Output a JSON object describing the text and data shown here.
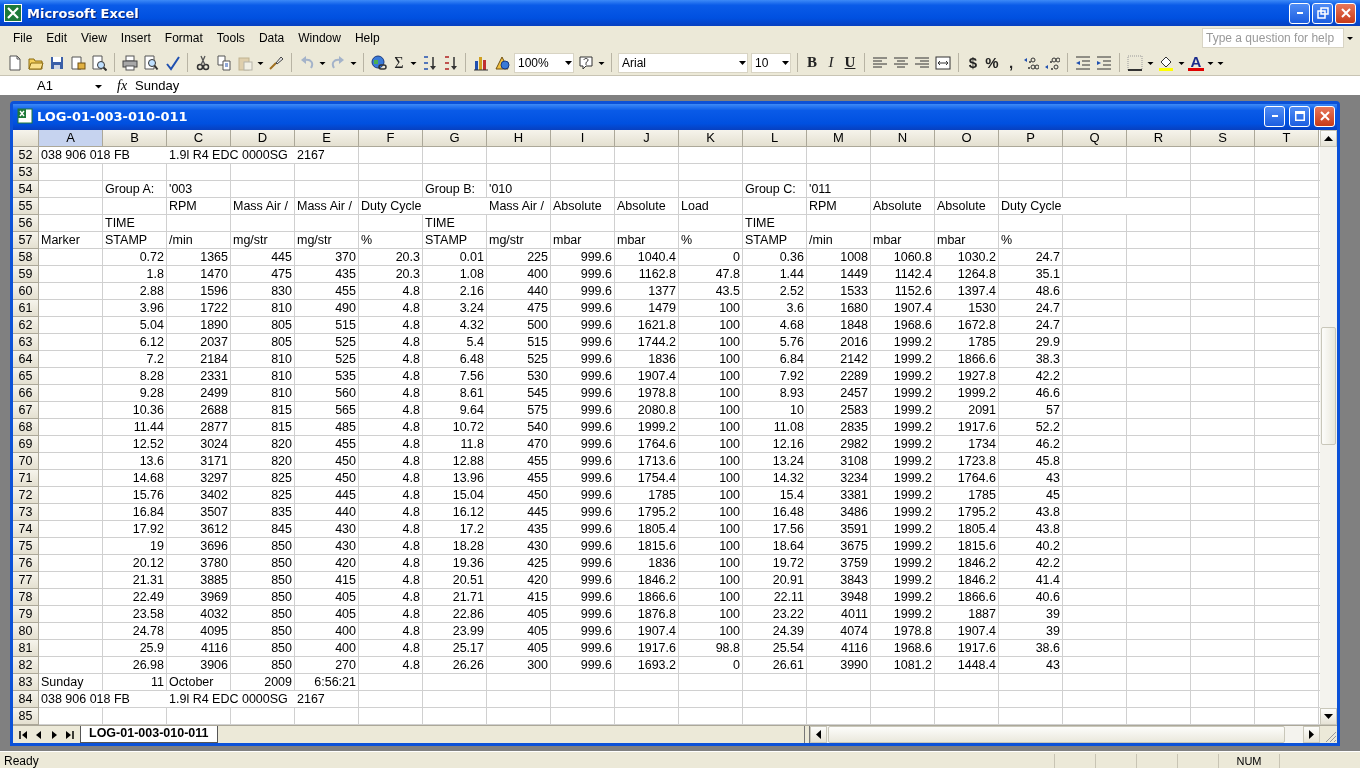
{
  "window": {
    "title": "Microsoft Excel"
  },
  "menu": [
    {
      "label": "File"
    },
    {
      "label": "Edit"
    },
    {
      "label": "View"
    },
    {
      "label": "Insert"
    },
    {
      "label": "Format"
    },
    {
      "label": "Tools"
    },
    {
      "label": "Data"
    },
    {
      "label": "Window"
    },
    {
      "label": "Help"
    }
  ],
  "help_search": {
    "placeholder": "Type a question for help"
  },
  "toolbar": {
    "undo": {
      "disabled": true
    },
    "redo": {
      "disabled": true
    },
    "paste": {
      "disabled": true
    },
    "sum": "Σ",
    "zoom": "100%",
    "font": "Arial",
    "font_size": "10",
    "bold": "B",
    "italic": "I",
    "underline": "U",
    "currency": "$",
    "percent": "%",
    "comma": ",",
    "font_color": "A"
  },
  "formula_bar": {
    "name_box": "A1",
    "fx": "fx",
    "value": "Sunday"
  },
  "workbook": {
    "title": "LOG-01-003-010-011",
    "columns": [
      {
        "label": "A",
        "selected": true
      },
      {
        "label": "B",
        "selected": false
      },
      {
        "label": "C",
        "selected": false
      },
      {
        "label": "D",
        "selected": false
      },
      {
        "label": "E",
        "selected": false
      },
      {
        "label": "F",
        "selected": false
      },
      {
        "label": "G",
        "selected": false
      },
      {
        "label": "H",
        "selected": false
      },
      {
        "label": "I",
        "selected": false
      },
      {
        "label": "J",
        "selected": false
      },
      {
        "label": "K",
        "selected": false
      },
      {
        "label": "L",
        "selected": false
      },
      {
        "label": "M",
        "selected": false
      },
      {
        "label": "N",
        "selected": false
      },
      {
        "label": "O",
        "selected": false
      },
      {
        "label": "P",
        "selected": false
      },
      {
        "label": "Q",
        "selected": false
      },
      {
        "label": "R",
        "selected": false
      },
      {
        "label": "S",
        "selected": false
      },
      {
        "label": "T",
        "selected": false
      }
    ],
    "rows": [
      {
        "header": "52",
        "kind": "text",
        "cells": [
          {
            "kind": "text",
            "text": "038 906 018 FB"
          },
          null,
          {
            "kind": "text",
            "text": "1.9l R4 EDC 0000SG"
          },
          null,
          {
            "kind": "text",
            "text": "2167"
          }
        ]
      },
      {
        "header": "53",
        "kind": "empty"
      },
      {
        "header": "54",
        "kind": "text",
        "cells": [
          null,
          {
            "kind": "text",
            "text": "Group A:"
          },
          {
            "kind": "text",
            "text": "'003"
          },
          null,
          null,
          null,
          {
            "kind": "text",
            "text": "Group B:"
          },
          {
            "kind": "text",
            "text": "'010"
          },
          null,
          null,
          null,
          {
            "kind": "text",
            "text": "Group C:"
          },
          {
            "kind": "text",
            "text": "'011"
          }
        ]
      },
      {
        "header": "55",
        "kind": "text",
        "cells": [
          null,
          null,
          {
            "kind": "text",
            "text": "RPM"
          },
          {
            "kind": "text",
            "text": "Mass Air /"
          },
          {
            "kind": "text",
            "text": "Mass Air /"
          },
          {
            "kind": "text",
            "text": "Duty Cycle"
          },
          null,
          {
            "kind": "text",
            "text": "Mass Air /"
          },
          {
            "kind": "text",
            "text": "Absolute"
          },
          {
            "kind": "text",
            "text": "Absolute"
          },
          {
            "kind": "text",
            "text": "Load"
          },
          null,
          {
            "kind": "text",
            "text": "RPM"
          },
          {
            "kind": "text",
            "text": "Absolute"
          },
          {
            "kind": "text",
            "text": "Absolute"
          },
          {
            "kind": "text",
            "text": "Duty Cycle"
          }
        ]
      },
      {
        "header": "56",
        "kind": "text",
        "cells": [
          null,
          {
            "kind": "text",
            "text": "TIME"
          },
          null,
          null,
          null,
          null,
          {
            "kind": "text",
            "text": "TIME"
          },
          null,
          null,
          null,
          null,
          {
            "kind": "text",
            "text": "TIME"
          }
        ]
      },
      {
        "header": "57",
        "kind": "text",
        "cells": [
          {
            "kind": "text",
            "text": "Marker"
          },
          {
            "kind": "text",
            "text": "STAMP"
          },
          {
            "kind": "text",
            "text": "/min"
          },
          {
            "kind": "text",
            "text": "mg/str"
          },
          {
            "kind": "text",
            "text": "mg/str"
          },
          {
            "kind": "text",
            "text": "%"
          },
          {
            "kind": "text",
            "text": "STAMP"
          },
          {
            "kind": "text",
            "text": "mg/str"
          },
          {
            "kind": "text",
            "text": "mbar"
          },
          {
            "kind": "text",
            "text": "mbar"
          },
          {
            "kind": "text",
            "text": "%"
          },
          {
            "kind": "text",
            "text": "STAMP"
          },
          {
            "kind": "text",
            "text": "/min"
          },
          {
            "kind": "text",
            "text": "mbar"
          },
          {
            "kind": "text",
            "text": "mbar"
          },
          {
            "kind": "text",
            "text": "%"
          }
        ]
      },
      {
        "header": "58",
        "kind": "data",
        "values": [
          "0.72",
          "1365",
          "445",
          "370",
          "20.3",
          "0.01",
          "225",
          "999.6",
          "1040.4",
          "0",
          "0.36",
          "1008",
          "1060.8",
          "1030.2",
          "24.7"
        ]
      },
      {
        "header": "59",
        "kind": "data",
        "values": [
          "1.8",
          "1470",
          "475",
          "435",
          "20.3",
          "1.08",
          "400",
          "999.6",
          "1162.8",
          "47.8",
          "1.44",
          "1449",
          "1142.4",
          "1264.8",
          "35.1"
        ]
      },
      {
        "header": "60",
        "kind": "data",
        "values": [
          "2.88",
          "1596",
          "830",
          "455",
          "4.8",
          "2.16",
          "440",
          "999.6",
          "1377",
          "43.5",
          "2.52",
          "1533",
          "1152.6",
          "1397.4",
          "48.6"
        ]
      },
      {
        "header": "61",
        "kind": "data",
        "values": [
          "3.96",
          "1722",
          "810",
          "490",
          "4.8",
          "3.24",
          "475",
          "999.6",
          "1479",
          "100",
          "3.6",
          "1680",
          "1907.4",
          "1530",
          "24.7"
        ]
      },
      {
        "header": "62",
        "kind": "data",
        "values": [
          "5.04",
          "1890",
          "805",
          "515",
          "4.8",
          "4.32",
          "500",
          "999.6",
          "1621.8",
          "100",
          "4.68",
          "1848",
          "1968.6",
          "1672.8",
          "24.7"
        ]
      },
      {
        "header": "63",
        "kind": "data",
        "values": [
          "6.12",
          "2037",
          "805",
          "525",
          "4.8",
          "5.4",
          "515",
          "999.6",
          "1744.2",
          "100",
          "5.76",
          "2016",
          "1999.2",
          "1785",
          "29.9"
        ]
      },
      {
        "header": "64",
        "kind": "data",
        "values": [
          "7.2",
          "2184",
          "810",
          "525",
          "4.8",
          "6.48",
          "525",
          "999.6",
          "1836",
          "100",
          "6.84",
          "2142",
          "1999.2",
          "1866.6",
          "38.3"
        ]
      },
      {
        "header": "65",
        "kind": "data",
        "values": [
          "8.28",
          "2331",
          "810",
          "535",
          "4.8",
          "7.56",
          "530",
          "999.6",
          "1907.4",
          "100",
          "7.92",
          "2289",
          "1999.2",
          "1927.8",
          "42.2"
        ]
      },
      {
        "header": "66",
        "kind": "data",
        "values": [
          "9.28",
          "2499",
          "810",
          "560",
          "4.8",
          "8.61",
          "545",
          "999.6",
          "1978.8",
          "100",
          "8.93",
          "2457",
          "1999.2",
          "1999.2",
          "46.6"
        ]
      },
      {
        "header": "67",
        "kind": "data",
        "values": [
          "10.36",
          "2688",
          "815",
          "565",
          "4.8",
          "9.64",
          "575",
          "999.6",
          "2080.8",
          "100",
          "10",
          "2583",
          "1999.2",
          "2091",
          "57"
        ]
      },
      {
        "header": "68",
        "kind": "data",
        "values": [
          "11.44",
          "2877",
          "815",
          "485",
          "4.8",
          "10.72",
          "540",
          "999.6",
          "1999.2",
          "100",
          "11.08",
          "2835",
          "1999.2",
          "1917.6",
          "52.2"
        ]
      },
      {
        "header": "69",
        "kind": "data",
        "values": [
          "12.52",
          "3024",
          "820",
          "455",
          "4.8",
          "11.8",
          "470",
          "999.6",
          "1764.6",
          "100",
          "12.16",
          "2982",
          "1999.2",
          "1734",
          "46.2"
        ]
      },
      {
        "header": "70",
        "kind": "data",
        "values": [
          "13.6",
          "3171",
          "820",
          "450",
          "4.8",
          "12.88",
          "455",
          "999.6",
          "1713.6",
          "100",
          "13.24",
          "3108",
          "1999.2",
          "1723.8",
          "45.8"
        ]
      },
      {
        "header": "71",
        "kind": "data",
        "values": [
          "14.68",
          "3297",
          "825",
          "450",
          "4.8",
          "13.96",
          "455",
          "999.6",
          "1754.4",
          "100",
          "14.32",
          "3234",
          "1999.2",
          "1764.6",
          "43"
        ]
      },
      {
        "header": "72",
        "kind": "data",
        "values": [
          "15.76",
          "3402",
          "825",
          "445",
          "4.8",
          "15.04",
          "450",
          "999.6",
          "1785",
          "100",
          "15.4",
          "3381",
          "1999.2",
          "1785",
          "45"
        ]
      },
      {
        "header": "73",
        "kind": "data",
        "values": [
          "16.84",
          "3507",
          "835",
          "440",
          "4.8",
          "16.12",
          "445",
          "999.6",
          "1795.2",
          "100",
          "16.48",
          "3486",
          "1999.2",
          "1795.2",
          "43.8"
        ]
      },
      {
        "header": "74",
        "kind": "data",
        "values": [
          "17.92",
          "3612",
          "845",
          "430",
          "4.8",
          "17.2",
          "435",
          "999.6",
          "1805.4",
          "100",
          "17.56",
          "3591",
          "1999.2",
          "1805.4",
          "43.8"
        ]
      },
      {
        "header": "75",
        "kind": "data",
        "values": [
          "19",
          "3696",
          "850",
          "430",
          "4.8",
          "18.28",
          "430",
          "999.6",
          "1815.6",
          "100",
          "18.64",
          "3675",
          "1999.2",
          "1815.6",
          "40.2"
        ]
      },
      {
        "header": "76",
        "kind": "data",
        "values": [
          "20.12",
          "3780",
          "850",
          "420",
          "4.8",
          "19.36",
          "425",
          "999.6",
          "1836",
          "100",
          "19.72",
          "3759",
          "1999.2",
          "1846.2",
          "42.2"
        ]
      },
      {
        "header": "77",
        "kind": "data",
        "values": [
          "21.31",
          "3885",
          "850",
          "415",
          "4.8",
          "20.51",
          "420",
          "999.6",
          "1846.2",
          "100",
          "20.91",
          "3843",
          "1999.2",
          "1846.2",
          "41.4"
        ]
      },
      {
        "header": "78",
        "kind": "data",
        "values": [
          "22.49",
          "3969",
          "850",
          "405",
          "4.8",
          "21.71",
          "415",
          "999.6",
          "1866.6",
          "100",
          "22.11",
          "3948",
          "1999.2",
          "1866.6",
          "40.6"
        ]
      },
      {
        "header": "79",
        "kind": "data",
        "values": [
          "23.58",
          "4032",
          "850",
          "405",
          "4.8",
          "22.86",
          "405",
          "999.6",
          "1876.8",
          "100",
          "23.22",
          "4011",
          "1999.2",
          "1887",
          "39"
        ]
      },
      {
        "header": "80",
        "kind": "data",
        "values": [
          "24.78",
          "4095",
          "850",
          "400",
          "4.8",
          "23.99",
          "405",
          "999.6",
          "1907.4",
          "100",
          "24.39",
          "4074",
          "1978.8",
          "1907.4",
          "39"
        ]
      },
      {
        "header": "81",
        "kind": "data",
        "values": [
          "25.9",
          "4116",
          "850",
          "400",
          "4.8",
          "25.17",
          "405",
          "999.6",
          "1917.6",
          "98.8",
          "25.54",
          "4116",
          "1968.6",
          "1917.6",
          "38.6"
        ]
      },
      {
        "header": "82",
        "kind": "data",
        "values": [
          "26.98",
          "3906",
          "850",
          "270",
          "4.8",
          "26.26",
          "300",
          "999.6",
          "1693.2",
          "0",
          "26.61",
          "3990",
          "1081.2",
          "1448.4",
          "43"
        ]
      },
      {
        "header": "83",
        "kind": "text",
        "cells": [
          {
            "kind": "text",
            "text": "Sunday"
          },
          {
            "kind": "number",
            "text": "11"
          },
          {
            "kind": "text",
            "text": "October"
          },
          {
            "kind": "number",
            "text": "2009"
          },
          {
            "kind": "number",
            "text": "6:56:21"
          }
        ]
      },
      {
        "header": "84",
        "kind": "text",
        "cells": [
          {
            "kind": "text",
            "text": "038 906 018 FB"
          },
          null,
          {
            "kind": "text",
            "text": "1.9l R4 EDC 0000SG"
          },
          null,
          {
            "kind": "text",
            "text": "2167"
          }
        ]
      },
      {
        "header": "85",
        "kind": "empty"
      }
    ],
    "sheet_tabs": [
      {
        "label": "LOG-01-003-010-011",
        "selected": true
      }
    ]
  },
  "status_bar": {
    "message": "Ready",
    "indicator": "NUM"
  }
}
